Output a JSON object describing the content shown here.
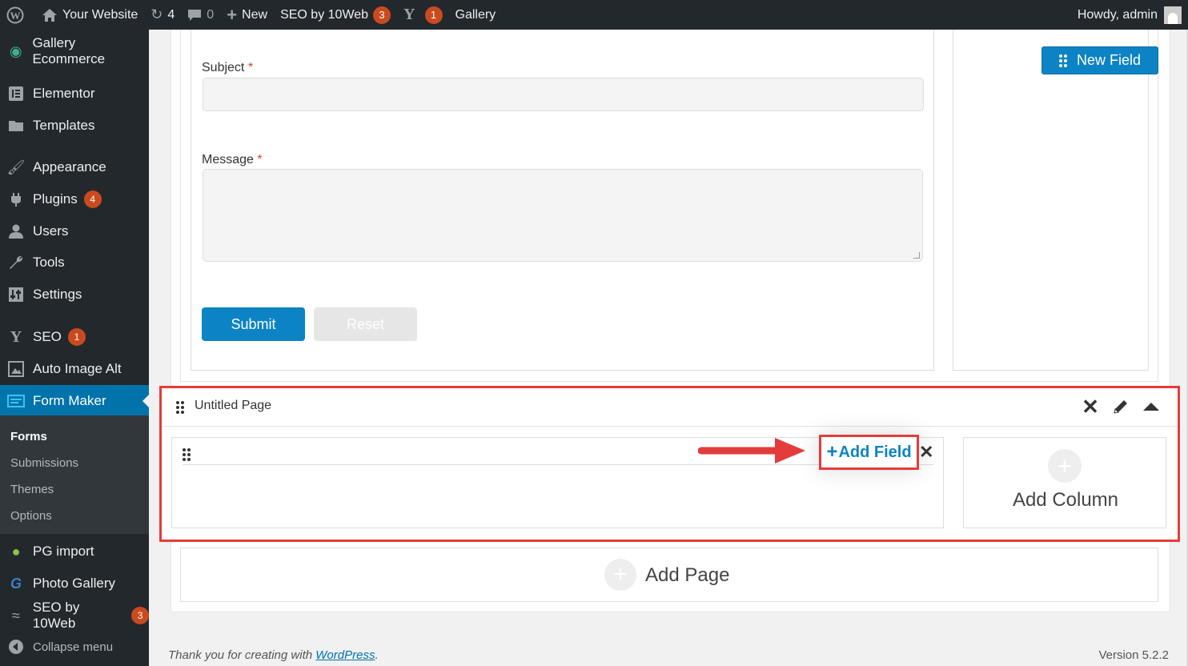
{
  "adminbar": {
    "site_name": "Your Website",
    "updates_count": "4",
    "comments_count": "0",
    "new_label": "New",
    "seo_label": "SEO by 10Web",
    "seo_count": "3",
    "yoast_count": "1",
    "gallery_label": "Gallery",
    "howdy": "Howdy, admin"
  },
  "sidebar": {
    "items": [
      {
        "label": "Gallery Ecommerce"
      },
      {
        "label": "Elementor"
      },
      {
        "label": "Templates"
      },
      {
        "label": "Appearance"
      },
      {
        "label": "Plugins",
        "badge": "4"
      },
      {
        "label": "Users"
      },
      {
        "label": "Tools"
      },
      {
        "label": "Settings"
      },
      {
        "label": "SEO",
        "badge": "1"
      },
      {
        "label": "Auto Image Alt"
      },
      {
        "label": "Form Maker"
      },
      {
        "label": "PG import"
      },
      {
        "label": "Photo Gallery"
      },
      {
        "label": "SEO by 10Web",
        "badge": "3"
      },
      {
        "label": "Collapse menu"
      }
    ],
    "submenu": [
      "Forms",
      "Submissions",
      "Themes",
      "Options"
    ]
  },
  "form": {
    "subject_label": "Subject",
    "message_label": "Message",
    "required_mark": "*",
    "submit_label": "Submit",
    "reset_label": "Reset"
  },
  "new_field_label": "New Field",
  "page": {
    "title": "Untitled Page",
    "add_field_label": "Add Field",
    "add_column_label": "Add Column",
    "add_page_label": "Add Page"
  },
  "footer": {
    "thanks_prefix": "Thank you for creating with ",
    "wordpress_link": "WordPress",
    "thanks_suffix": ".",
    "version": "Version 5.2.2"
  },
  "colors": {
    "accent": "#0c83c4",
    "highlight": "#e43b3b",
    "admin_bg": "#23282d"
  }
}
